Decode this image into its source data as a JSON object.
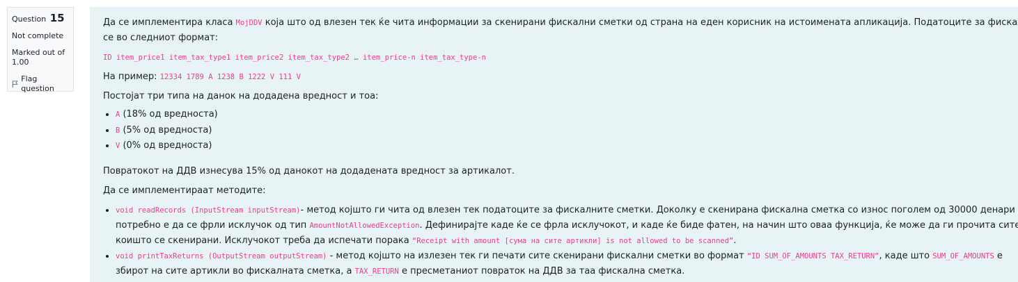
{
  "info": {
    "question_label": "Question",
    "question_number": "15",
    "state": "Not complete",
    "grade_line1": "Marked out of",
    "grade_line2": "1.00",
    "flag_label": "Flag question"
  },
  "text": {
    "p1_a": "Да се имплементира класа ",
    "p1_code": "MojDDV",
    "p1_b": " која што од влезен тек ќе чита информации за скенирани фискални сметки од страна на еден корисник на истоимената апликација. Податоците за фискалните сметки",
    "p1_c": "се во следниот формат:",
    "format_code": "ID item_price1 item_tax_type1 item_price2 item_tax_type2 … item_price-n item_tax_type-n",
    "example_label": "На пример: ",
    "example_code": "12334 1789 A 1238 B 1222 V 111 V",
    "types_intro": "Постојат три типа на данок на додадена вредност и тоа:",
    "types": [
      {
        "code": "A",
        "desc": " (18% од вредноста)"
      },
      {
        "code": "B",
        "desc": " (5% од вредноста)"
      },
      {
        "code": "V",
        "desc": " (0% од вредноста)"
      }
    ],
    "refund": "Повратокот на ДДВ изнесува 15% од данокот на додадената вредност за артикалот.",
    "methods_intro": "Да се имплементираат методите:",
    "m1_code": "void readRecords (InputStream inputStream)",
    "m1_a": "- метод којшто ги чита од влезен тек податоците за фискалните сметки. Доколку е скенирана фискална сметка со износ поголем од 30000 денари",
    "m1_b": "потребно е да се фрли исклучок од тип ",
    "m1_exc": "AmountNotAllowedException",
    "m1_c": ". Дефинирајте каде ќе се фрла исклучокот, и каде ќе биде фатен, на начин што оваа функција, ќе може да ги прочита сите фискални",
    "m1_d": "коишто се скенирани. Исклучокот треба да испечати порака ",
    "m1_msg": "“Receipt with amount [сума на сите артикли] is not allowed to be scanned”",
    "m1_e": ".",
    "m2_code": "void printTaxReturns (OutputStream outputStream)",
    "m2_a": " - метод којшто на излезен тек ги печати сите скенирани фискални сметки во формат ",
    "m2_fmt": "“ID SUM_OF_AMOUNTS TAX_RETURN”",
    "m2_b": ", каде што ",
    "m2_sum": "SUM_OF_AMOUNTS",
    "m2_c": " е",
    "m2_d": "збирот на сите артикли во фискалната сметка, а ",
    "m2_tax": "TAX_RETURN",
    "m2_e": " е пресметаниот повраток на ДДВ за таа фискална сметка."
  }
}
